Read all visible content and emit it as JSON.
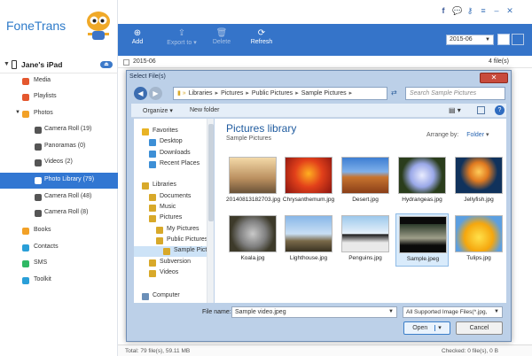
{
  "app": {
    "brand": "FoneTrans",
    "device": "Jane's iPad"
  },
  "nav": [
    {
      "label": "Media",
      "color": "#e4572e"
    },
    {
      "label": "Playlists",
      "color": "#e4572e"
    },
    {
      "label": "Photos",
      "color": "#f2a127"
    },
    {
      "label": "Camera Roll (19)",
      "color": "#555555"
    },
    {
      "label": "Panoramas (0)",
      "color": "#555555"
    },
    {
      "label": "Videos (2)",
      "color": "#555555"
    },
    {
      "label": "Photo Library (79)",
      "color": "#ffffff"
    },
    {
      "label": "Camera Roll (48)",
      "color": "#555555"
    },
    {
      "label": "Camera Roll (8)",
      "color": "#555555"
    },
    {
      "label": "Books",
      "color": "#f2a127"
    },
    {
      "label": "Contacts",
      "color": "#2a9fd8"
    },
    {
      "label": "SMS",
      "color": "#2fb864"
    },
    {
      "label": "Toolkit",
      "color": "#2a9fd8"
    }
  ],
  "toolbar": {
    "add": "Add",
    "export": "Export to",
    "delete": "Delete",
    "refresh": "Refresh",
    "date": "2015-06"
  },
  "content": {
    "group_date": "2015-06",
    "group_count": "4 file(s)",
    "status_total": "Total: 79 file(s), 59.11 MB",
    "status_checked": "Checked: 0 file(s), 0 B"
  },
  "dialog": {
    "title": "Select File(s)",
    "close": "✕",
    "address": [
      "Libraries",
      "Pictures",
      "Public Pictures",
      "Sample Pictures"
    ],
    "search_placeholder": "Search Sample Pictures",
    "organize": "Organize",
    "new_folder": "New folder",
    "tree": [
      {
        "label": "Favorites",
        "indent": 0
      },
      {
        "label": "Desktop",
        "indent": 1
      },
      {
        "label": "Downloads",
        "indent": 1
      },
      {
        "label": "Recent Places",
        "indent": 1
      },
      {
        "label": "Libraries",
        "indent": 0
      },
      {
        "label": "Documents",
        "indent": 1
      },
      {
        "label": "Music",
        "indent": 1
      },
      {
        "label": "Pictures",
        "indent": 1
      },
      {
        "label": "My Pictures",
        "indent": 2
      },
      {
        "label": "Public Pictures",
        "indent": 2
      },
      {
        "label": "Sample Pictu",
        "indent": 3
      },
      {
        "label": "Subversion",
        "indent": 1
      },
      {
        "label": "Videos",
        "indent": 1
      },
      {
        "label": "Computer",
        "indent": 0
      }
    ],
    "library_title": "Pictures library",
    "library_sub": "Sample Pictures",
    "arrange_label": "Arrange by:",
    "arrange_value": "Folder",
    "files": [
      {
        "caption": "20140813182703.jpg",
        "bg": "linear-gradient(180deg,#f3d9a8,#b98e5e 60%,#6a5238)"
      },
      {
        "caption": "Chrysanthemum.jpg",
        "bg": "radial-gradient(circle at 50% 45%,#ffb020,#e2401a 45%,#8a1510)"
      },
      {
        "caption": "Desert.jpg",
        "bg": "linear-gradient(180deg,#3d7ed2 0%,#7fb0ea 40%,#c8742f 55%,#8a3e18)"
      },
      {
        "caption": "Hydrangeas.jpg",
        "bg": "radial-gradient(circle at 50% 50%,#e9ecff,#9aa8e8 40%,#2a3d1c 70%)"
      },
      {
        "caption": "Jellyfish.jpg",
        "bg": "radial-gradient(circle at 50% 40%,#ffcc5a,#e07a20 30%,#10325c 60%)"
      },
      {
        "caption": "Koala.jpg",
        "bg": "radial-gradient(circle at 50% 50%,#c9c9c9,#7f7f7f 45%,#3d3a2a 75%)"
      },
      {
        "caption": "Lighthouse.jpg",
        "bg": "linear-gradient(180deg,#88b7e8,#c9dff4 50%,#7a6a4a 70%,#3a3322)"
      },
      {
        "caption": "Penguins.jpg",
        "bg": "linear-gradient(180deg,#9cc8ec,#e8f2fa 50%,#1a1a1a 52%,#e9e9e9 75%)"
      },
      {
        "caption": "Sample.jpeg",
        "bg": "linear-gradient(180deg,#0a0a0a 0%,#0a0a0a 20%,#2b3a2a 20%,#9f9f8a 60%,#0a0a0a 80%)"
      },
      {
        "caption": "Tulips.jpg",
        "bg": "radial-gradient(circle at 50% 60%,#ffe14a,#f5a70e 45%,#5c9fe0 75%)"
      }
    ],
    "filename_label": "File name:",
    "filename_value": "Sample video.jpeg",
    "filter_value": "All Supported Image Files(*.jpg,",
    "open": "Open",
    "cancel": "Cancel"
  }
}
